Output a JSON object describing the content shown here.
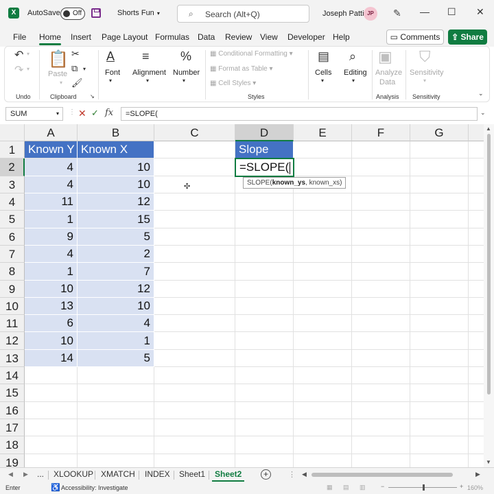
{
  "titlebar": {
    "logo": "X",
    "autosave_label": "AutoSave",
    "autosave_state": "Off",
    "doc_title": "Shorts Fun",
    "search_placeholder": "Search (Alt+Q)",
    "user_name": "Joseph Patti",
    "user_initials": "JP"
  },
  "menu": {
    "tabs": [
      "File",
      "Home",
      "Insert",
      "Page Layout",
      "Formulas",
      "Data",
      "Review",
      "View",
      "Developer",
      "Help"
    ],
    "active": "Home",
    "comments_label": "Comments",
    "share_label": "Share"
  },
  "ribbon": {
    "groups": {
      "undo": "Undo",
      "clipboard": "Clipboard",
      "styles": "Styles",
      "analysis": "Analysis",
      "sensitivity": "Sensitivity"
    },
    "paste_label": "Paste",
    "font_label": "Font",
    "alignment_label": "Alignment",
    "number_label": "Number",
    "conditional_formatting": "Conditional Formatting",
    "format_as_table": "Format as Table",
    "cell_styles": "Cell Styles",
    "cells_label": "Cells",
    "editing_label": "Editing",
    "analyze_data_line1": "Analyze",
    "analyze_data_line2": "Data",
    "sensitivity_label": "Sensitivity"
  },
  "formula_bar": {
    "name_box": "SUM",
    "fx": "fx",
    "content": "=SLOPE("
  },
  "sheet": {
    "columns": [
      "A",
      "B",
      "C",
      "D",
      "E",
      "F",
      "G"
    ],
    "selected_column": "D",
    "selected_row": "2",
    "rows": [
      "1",
      "2",
      "3",
      "4",
      "5",
      "6",
      "7",
      "8",
      "9",
      "10",
      "11",
      "12",
      "13",
      "14",
      "15",
      "16",
      "17",
      "18",
      "19"
    ],
    "header_a": "Known Y",
    "header_b": "Known X",
    "header_d": "Slope",
    "known_y": [
      "4",
      "4",
      "11",
      "1",
      "9",
      "4",
      "1",
      "10",
      "13",
      "6",
      "10",
      "14"
    ],
    "known_x": [
      "10",
      "10",
      "12",
      "15",
      "5",
      "2",
      "7",
      "12",
      "10",
      "4",
      "1",
      "5"
    ],
    "editing_cell_text": "=SLOPE(",
    "tooltip_func": "SLOPE(",
    "tooltip_arg1": "known_ys",
    "tooltip_rest": ", known_xs)"
  },
  "sheet_tabs": {
    "overflow": "...",
    "tabs": [
      "XLOOKUP",
      "XMATCH",
      "INDEX",
      "Sheet1",
      "Sheet2"
    ],
    "active": "Sheet2"
  },
  "status": {
    "mode": "Enter",
    "accessibility": "Accessibility: Investigate",
    "zoom": "160%"
  },
  "colors": {
    "accent": "#107c41",
    "table_header": "#4472c4",
    "table_band": "#d9e1f2"
  }
}
